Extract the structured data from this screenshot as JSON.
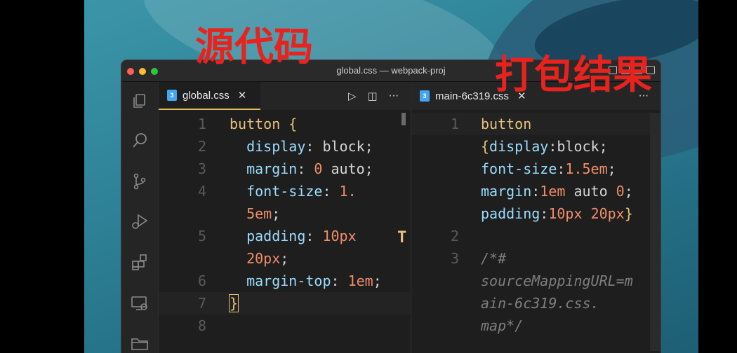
{
  "window": {
    "title": "global.css — webpack-proj"
  },
  "activity_bar": [
    {
      "name": "explorer-icon"
    },
    {
      "name": "search-icon"
    },
    {
      "name": "source-control-icon"
    },
    {
      "name": "run-debug-icon"
    },
    {
      "name": "extensions-icon"
    },
    {
      "name": "remote-explorer-icon"
    },
    {
      "name": "folder-icon"
    }
  ],
  "left_pane": {
    "tab": {
      "badge": "3",
      "label": "global.css",
      "close": "✕"
    },
    "tools": {
      "run": "▷",
      "split": "◫",
      "more": "···"
    },
    "lines": [
      {
        "n": "1",
        "tokens": [
          [
            "kw-sel",
            "button "
          ],
          [
            "kw-brace",
            "{"
          ]
        ]
      },
      {
        "n": "2",
        "tokens": [
          [
            "prop",
            "  display"
          ],
          [
            "plain",
            ": "
          ],
          [
            "plain",
            "block;"
          ]
        ]
      },
      {
        "n": "3",
        "tokens": [
          [
            "prop",
            "  margin"
          ],
          [
            "plain",
            ": "
          ],
          [
            "num",
            "0"
          ],
          [
            "plain",
            " auto;"
          ]
        ]
      },
      {
        "n": "4",
        "tokens": [
          [
            "prop",
            "  font-size"
          ],
          [
            "plain",
            ": "
          ],
          [
            "num",
            "1."
          ]
        ]
      },
      {
        "n": "",
        "tokens": [
          [
            "num",
            "  5em"
          ],
          [
            "plain",
            ";"
          ]
        ]
      },
      {
        "n": "5",
        "tokens": [
          [
            "prop",
            "  padding"
          ],
          [
            "plain",
            ": "
          ],
          [
            "num",
            "10px"
          ]
        ]
      },
      {
        "n": "",
        "tokens": [
          [
            "num",
            "  20px"
          ],
          [
            "plain",
            ";"
          ]
        ]
      },
      {
        "n": "6",
        "tokens": [
          [
            "prop",
            "  margin-top"
          ],
          [
            "plain",
            ": "
          ],
          [
            "num",
            "1em"
          ],
          [
            "plain",
            ";"
          ]
        ]
      },
      {
        "n": "7",
        "tokens": [
          [
            "kw-brace",
            "}"
          ]
        ]
      },
      {
        "n": "8",
        "tokens": []
      }
    ]
  },
  "right_pane": {
    "tab": {
      "badge": "3",
      "label": "main-6c319.css",
      "close": "✕"
    },
    "tools": {
      "more": "···"
    },
    "lines": [
      {
        "n": "1",
        "tokens": [
          [
            "kw-sel",
            "button"
          ]
        ]
      },
      {
        "n": "",
        "tokens": [
          [
            "kw-brace",
            "{"
          ],
          [
            "prop",
            "display"
          ],
          [
            "plain",
            ":block;"
          ]
        ]
      },
      {
        "n": "",
        "tokens": [
          [
            "prop",
            "font-size"
          ],
          [
            "plain",
            ":"
          ],
          [
            "num",
            "1.5em"
          ],
          [
            "plain",
            ";"
          ]
        ]
      },
      {
        "n": "",
        "tokens": [
          [
            "prop",
            "margin"
          ],
          [
            "plain",
            ":"
          ],
          [
            "num",
            "1em"
          ],
          [
            "plain",
            " auto "
          ],
          [
            "num",
            "0"
          ],
          [
            "plain",
            ";"
          ]
        ]
      },
      {
        "n": "",
        "tokens": [
          [
            "prop",
            "padding"
          ],
          [
            "plain",
            ":"
          ],
          [
            "num",
            "10px"
          ],
          [
            "plain",
            " "
          ],
          [
            "num",
            "20px"
          ],
          [
            "kw-brace",
            "}"
          ]
        ]
      },
      {
        "n": "2",
        "tokens": []
      },
      {
        "n": "3",
        "tokens": [
          [
            "comment",
            "/*#"
          ]
        ]
      },
      {
        "n": "",
        "tokens": [
          [
            "comment",
            "sourceMappingURL=m"
          ]
        ]
      },
      {
        "n": "",
        "tokens": [
          [
            "comment",
            "ain-6c319.css."
          ]
        ]
      },
      {
        "n": "",
        "tokens": [
          [
            "comment",
            "map*/"
          ]
        ]
      }
    ]
  },
  "annotations": {
    "source": "源代码",
    "bundle": "打包结果"
  },
  "colors": {
    "accent": "#e6c07b",
    "annotation_red": "#e8231e",
    "css_badge": "#42a5f5"
  }
}
